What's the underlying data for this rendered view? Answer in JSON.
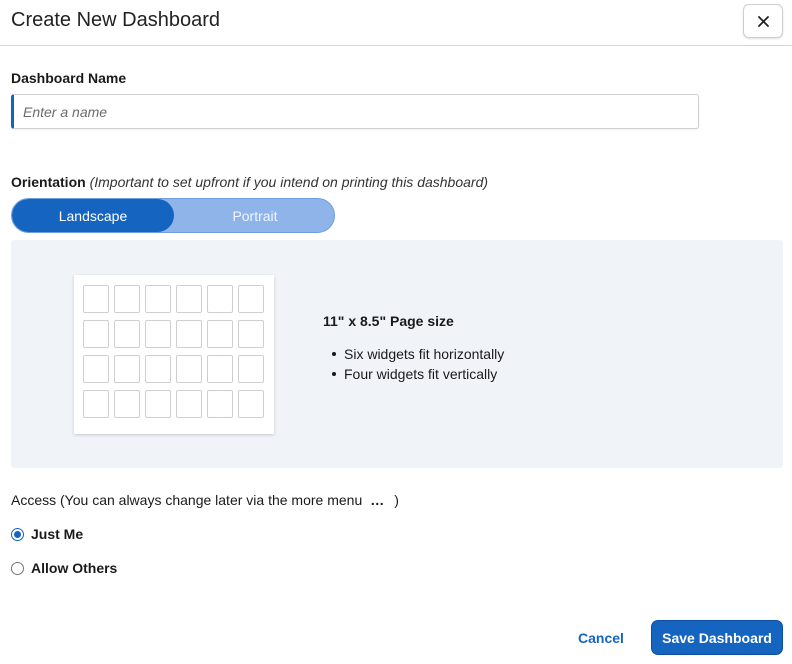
{
  "dialog": {
    "title": "Create New Dashboard",
    "close_icon": "close-icon"
  },
  "dashboard_name": {
    "label": "Dashboard Name",
    "value": "",
    "placeholder": "Enter a name"
  },
  "orientation": {
    "label": "Orientation",
    "hint": "(Important to set upfront if you intend on printing this dashboard)",
    "options": [
      "Landscape",
      "Portrait"
    ],
    "selected": "Landscape"
  },
  "preview": {
    "page_size": "11\" x 8.5\" Page size",
    "facts": [
      "Six widgets fit horizontally",
      "Four widgets fit vertically"
    ],
    "grid_columns": 6,
    "grid_rows": 4
  },
  "access": {
    "label": "Access (You can always change later via the more menu",
    "more_icon": "…",
    "close_paren": ")",
    "options": [
      "Just Me",
      "Allow Others"
    ],
    "selected": "Just Me"
  },
  "footer": {
    "cancel_label": "Cancel",
    "save_label": "Save Dashboard"
  },
  "colors": {
    "accent": "#1565c0",
    "toggle_inactive": "#8fb4ea",
    "preview_bg": "#f0f4f9"
  }
}
